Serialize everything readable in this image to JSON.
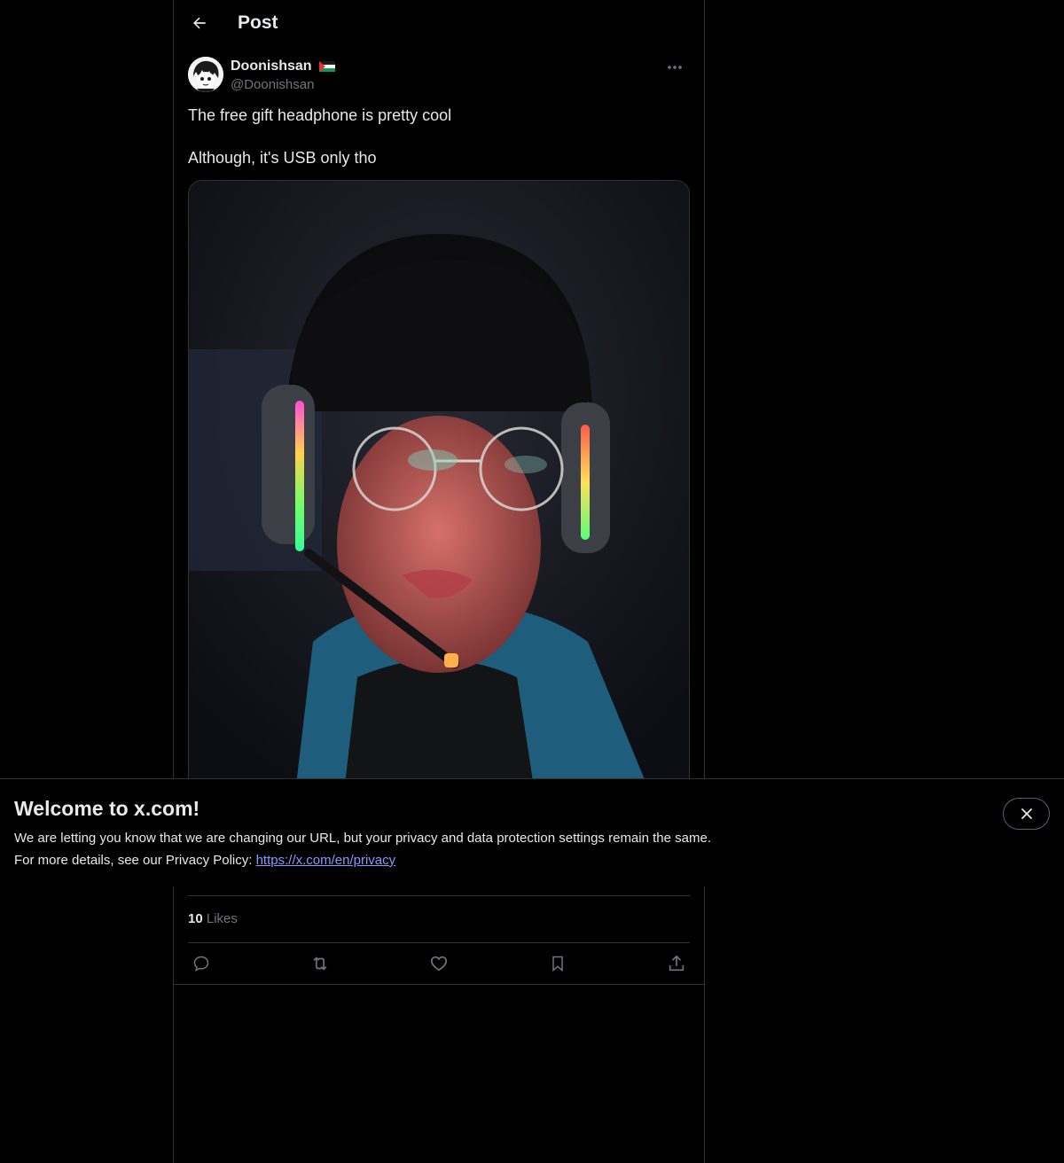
{
  "header": {
    "title": "Post",
    "back_icon": "arrow-left-icon"
  },
  "author": {
    "display_name": "Doonishsan",
    "handle": "@Doonishsan",
    "flag": "palestine-flag-icon"
  },
  "post": {
    "lines": [
      "The free gift headphone is pretty cool",
      "Although, it's USB only tho"
    ],
    "image_desc_icon": "photo"
  },
  "engagement": {
    "likes_count": "10",
    "likes_label": "Likes"
  },
  "actions": [
    "reply-icon",
    "repost-icon",
    "like-icon",
    "bookmark-icon",
    "share-icon"
  ],
  "banner": {
    "title": "Welcome to x.com!",
    "line1": "We are letting you know that we are changing our URL, but your privacy and data protection settings remain the same.",
    "line2_prefix": "For more details, see our Privacy Policy: ",
    "link": "https://x.com/en/privacy"
  },
  "colors": {
    "background": "#000000",
    "text": "#e7e9ea",
    "muted": "#71767b",
    "border": "#2f3336",
    "link": "#8b98ff"
  }
}
